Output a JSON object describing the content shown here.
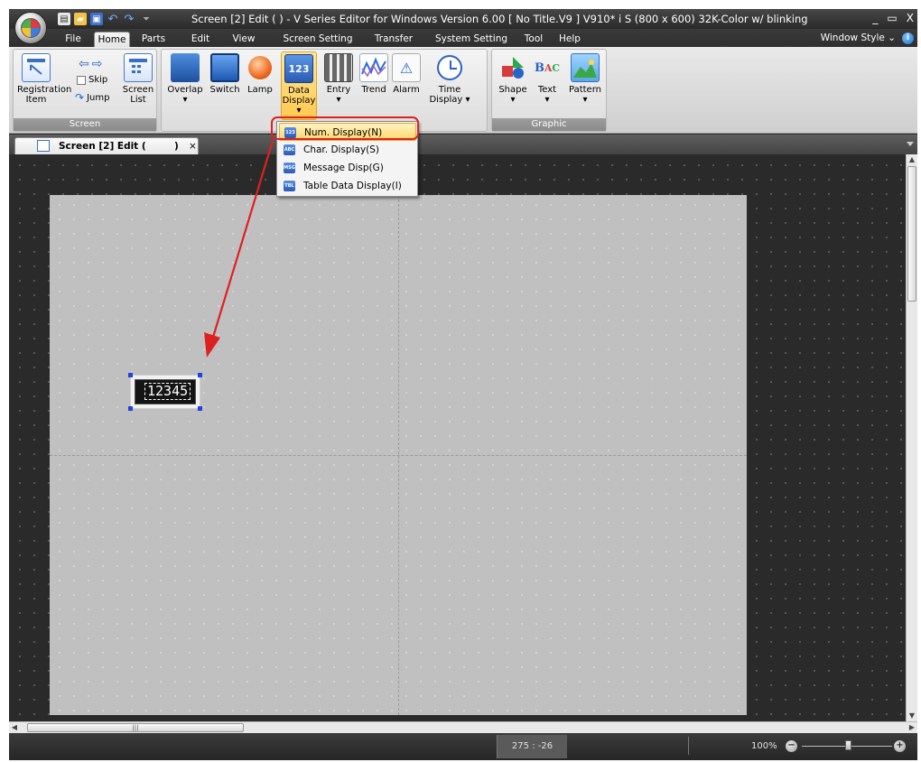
{
  "title_bar": {
    "title": "Screen [2] Edit (              ) - V Series Editor for Windows Version 6.00 [ No Title.V9 ] V910* i S (800 x 600) 32K-Color w/  blinking",
    "minimize": "_",
    "restore": "▭",
    "close": "X"
  },
  "ribbon_tabs": [
    "File",
    "Home",
    "Parts",
    "Edit",
    "View",
    "Screen Setting",
    "Transfer",
    "System Setting",
    "Tool",
    "Help"
  ],
  "window_style_label": "Window Style",
  "ribbon": {
    "screen_group": {
      "label": "Screen",
      "registration_item": "Registration Item",
      "skip": "Skip",
      "jump": "Jump",
      "screen_list": "Screen List"
    },
    "parts_buttons": [
      "Overlap",
      "Switch",
      "Lamp",
      "Data Display",
      "Entry",
      "Trend",
      "Alarm",
      "Time Display"
    ],
    "graphic_group": {
      "label": "Graphic",
      "buttons": [
        "Shape",
        "Text",
        "Pattern"
      ]
    }
  },
  "data_display_menu": {
    "items": [
      {
        "label": "Num. Display(N)",
        "icon": "num-display-icon",
        "icon_text": "123",
        "highlighted": true
      },
      {
        "label": "Char. Display(S)",
        "icon": "char-display-icon",
        "icon_text": "ABC",
        "highlighted": false
      },
      {
        "label": "Message Disp(G)",
        "icon": "message-display-icon",
        "icon_text": "MSG",
        "highlighted": false
      },
      {
        "label": "Table Data Display(I)",
        "icon": "table-data-display-icon",
        "icon_text": "TBL",
        "highlighted": false
      }
    ]
  },
  "document_tab": {
    "label": "Screen [2] Edit (",
    "label_suffix": ")",
    "close": "×"
  },
  "canvas": {
    "num_display_value": "12345"
  },
  "statusbar": {
    "coordinates": "275 : -26",
    "zoom": "100%"
  },
  "colors": {
    "annotation_red": "#e02020",
    "handle_blue": "#2340e0",
    "selected_gold": "#ffc94d"
  }
}
